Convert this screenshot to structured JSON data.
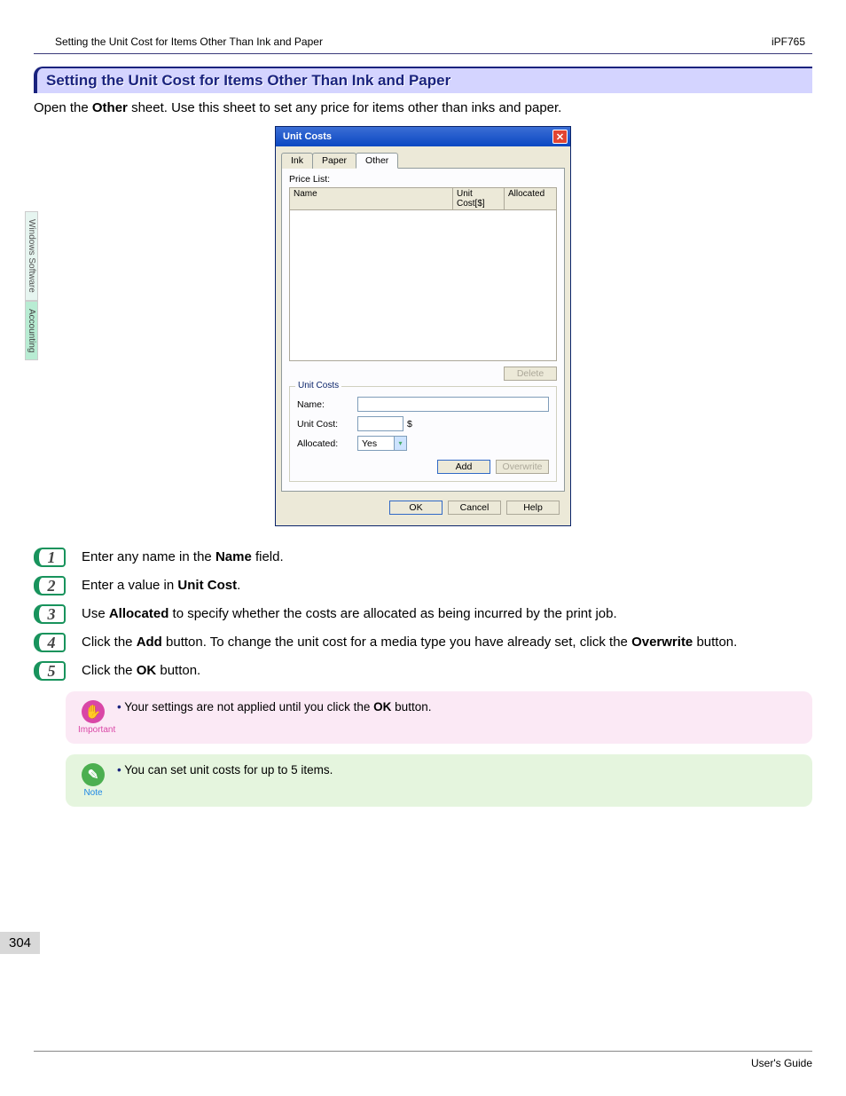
{
  "header": {
    "breadcrumb": "Setting the Unit Cost for Items Other Than Ink and Paper",
    "model": "iPF765"
  },
  "sidebar": {
    "tab1": "Windows Software",
    "tab2": "Accounting"
  },
  "title": "Setting the Unit Cost for Items Other Than Ink and Paper",
  "intro": {
    "pre": "Open the ",
    "bold": "Other",
    "post": " sheet. Use this sheet to set any price for items other than inks and paper."
  },
  "dialog": {
    "title": "Unit Costs",
    "tabs": {
      "ink": "Ink",
      "paper": "Paper",
      "other": "Other"
    },
    "price_list_label": "Price List:",
    "columns": {
      "name": "Name",
      "unit_cost": "Unit Cost[$]",
      "allocated": "Allocated"
    },
    "delete_btn": "Delete",
    "group_title": "Unit Costs",
    "fields": {
      "name_label": "Name:",
      "unit_cost_label": "Unit Cost:",
      "currency": "$",
      "allocated_label": "Allocated:",
      "allocated_value": "Yes"
    },
    "add_btn": "Add",
    "overwrite_btn": "Overwrite",
    "ok_btn": "OK",
    "cancel_btn": "Cancel",
    "help_btn": "Help"
  },
  "steps": [
    {
      "n": "1",
      "pre": "Enter any name in the ",
      "b1": "Name",
      "post": " field."
    },
    {
      "n": "2",
      "pre": "Enter a value in ",
      "b1": "Unit Cost",
      "post": "."
    },
    {
      "n": "3",
      "pre": "Use ",
      "b1": "Allocated",
      "post": " to specify whether the costs are allocated as being incurred by the print job."
    },
    {
      "n": "4",
      "pre": "Click the ",
      "b1": "Add",
      "mid": " button. To change the unit cost for a media type you have already set, click the ",
      "b2": "Overwrite",
      "post": " button."
    },
    {
      "n": "5",
      "pre": "Click the ",
      "b1": "OK",
      "post": " button."
    }
  ],
  "important": {
    "label": "Important",
    "pre": "Your settings are not applied until you click the ",
    "b": "OK",
    "post": " button."
  },
  "note": {
    "label": "Note",
    "text": "You can set unit costs for up to 5 items."
  },
  "page_number": "304",
  "footer": "User's Guide"
}
